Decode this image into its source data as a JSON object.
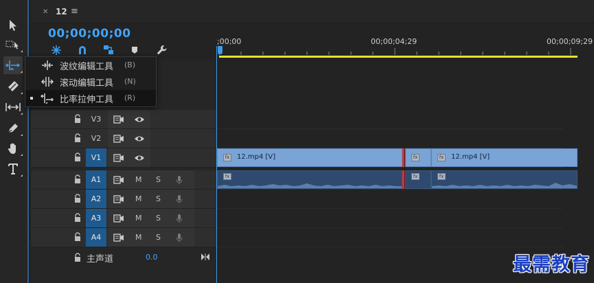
{
  "panel": {
    "tab_title": "12",
    "timecode": "00;00;00;00"
  },
  "ruler": {
    "labels": [
      ";00;00",
      "00;00;04;29",
      "00;00;09;29"
    ]
  },
  "flyout": {
    "items": [
      {
        "label": "波纹编辑工具",
        "key": "(B)"
      },
      {
        "label": "滚动编辑工具",
        "key": "(N)"
      },
      {
        "label": "比率拉伸工具",
        "key": "(R)"
      }
    ]
  },
  "tracks": {
    "video": [
      "V3",
      "V2",
      "V1"
    ],
    "audio": [
      "A1",
      "A2",
      "A3",
      "A4"
    ],
    "m_label": "M",
    "s_label": "S"
  },
  "master": {
    "name": "主声道",
    "value": "0.0"
  },
  "clips": {
    "v1_left": "12.mp4 [V]",
    "v1_right": "12.mp4 [V]",
    "fx": "fx"
  },
  "colors": {
    "accent": "#3d9be9",
    "timecode": "#3fa5ff",
    "video_clip": "#7aa3d6",
    "audio_clip": "#2f4a6e",
    "workbar": "#e6e32b",
    "cut_mark": "#e22a2a",
    "watermark": "#1b3fbf"
  },
  "icons": {
    "tools": [
      "selection-arrow-icon",
      "track-select-icon",
      "ripple-edit-icon",
      "razor-icon",
      "slip-icon",
      "pen-icon",
      "hand-icon",
      "type-icon"
    ]
  },
  "watermark": "最需教育"
}
